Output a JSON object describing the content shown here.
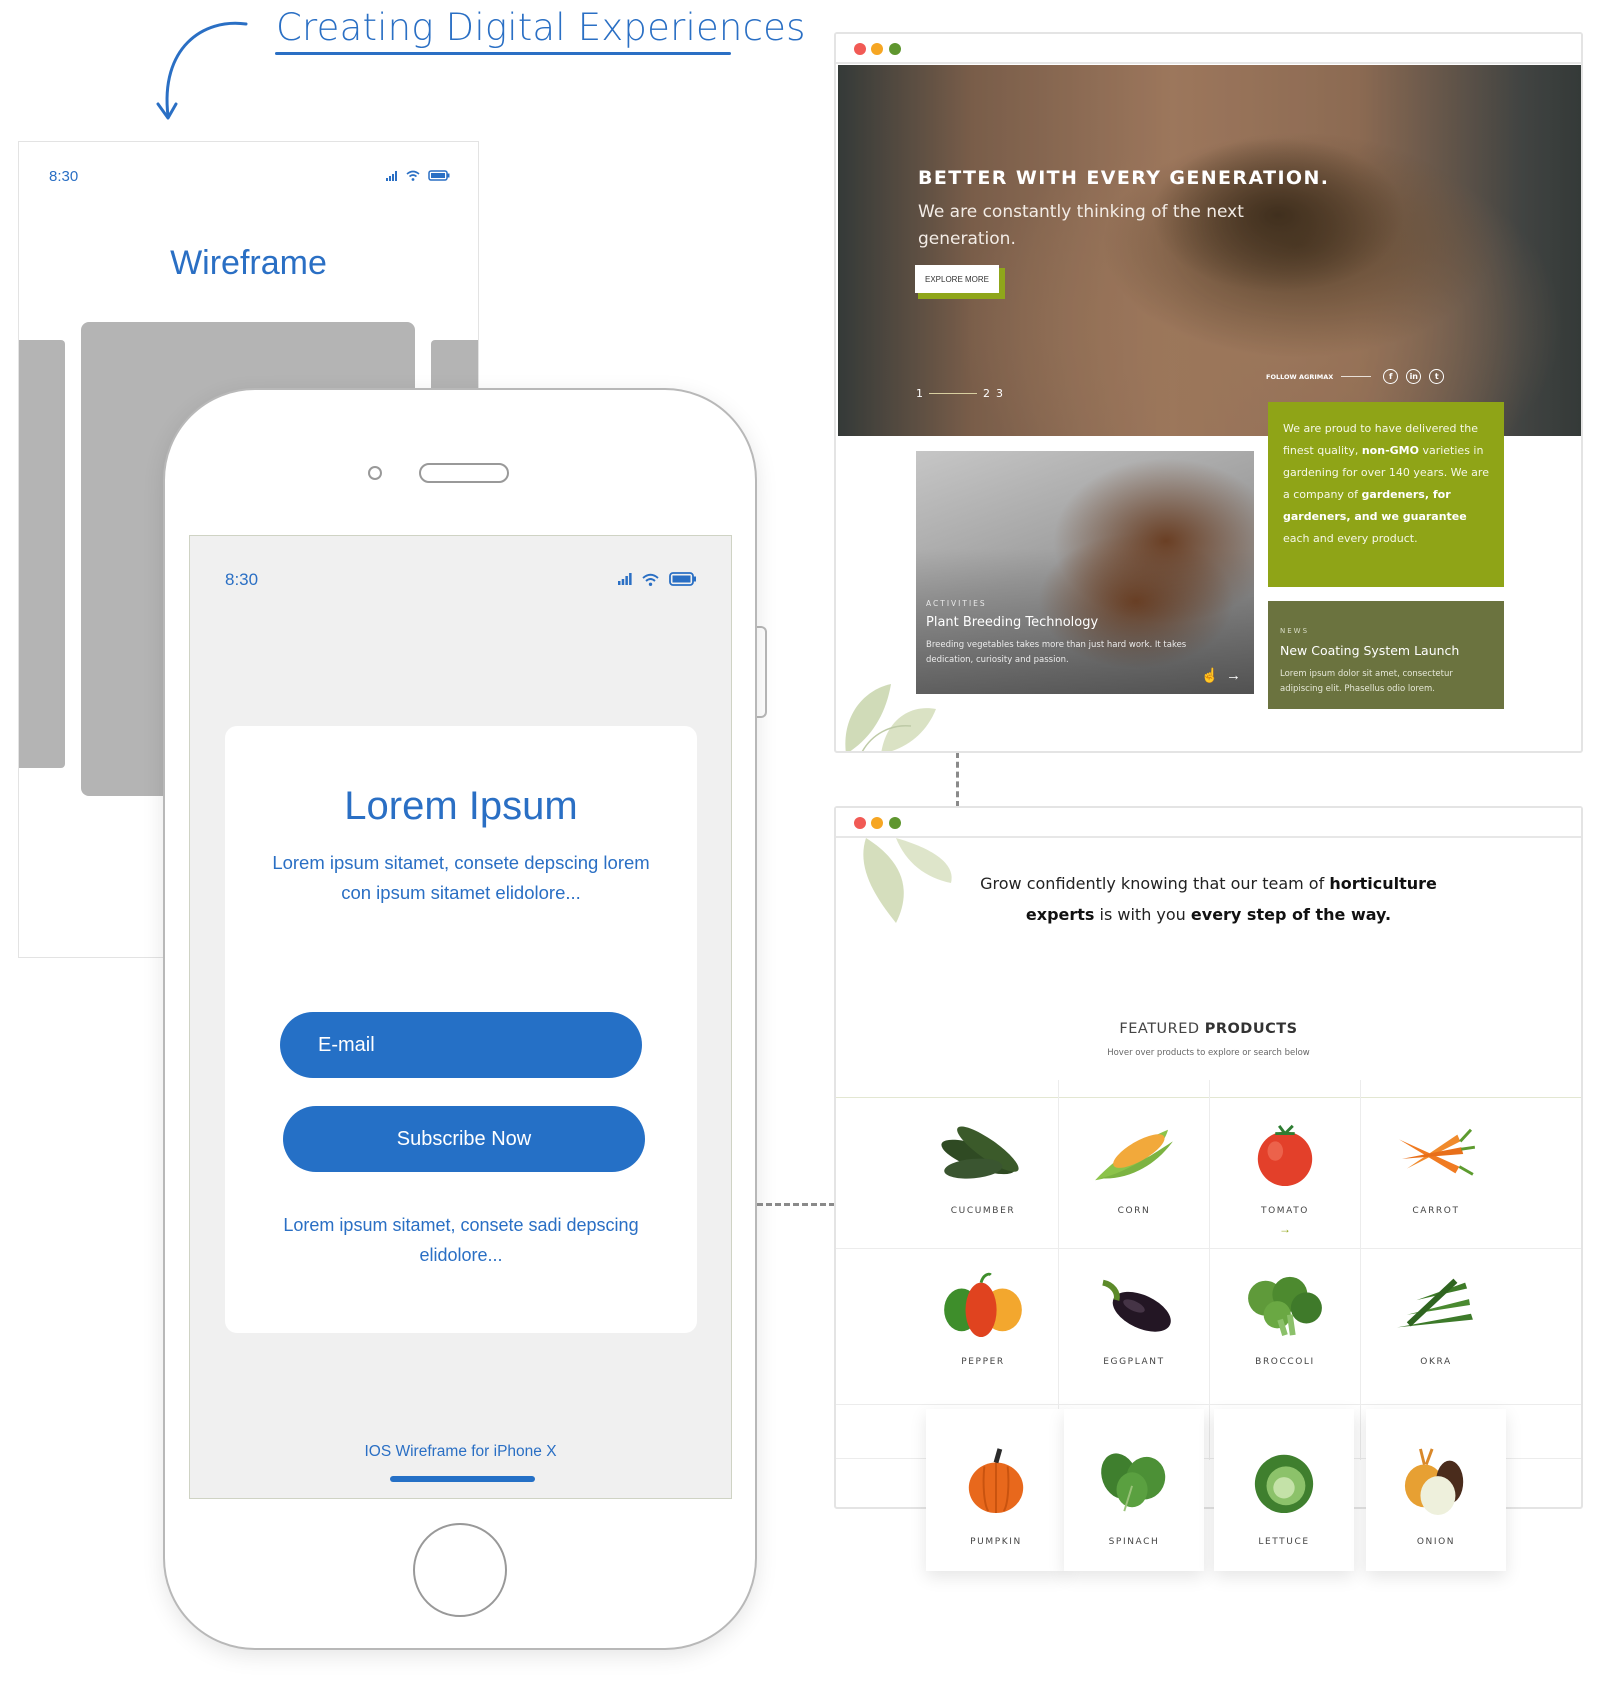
{
  "headline": {
    "text": "Creating Digital Experiences"
  },
  "wireframe_card": {
    "time": "8:30",
    "title": "Wireframe",
    "status_icons": [
      "signal-icon",
      "wifi-icon",
      "battery-icon"
    ]
  },
  "phone": {
    "time": "8:30",
    "status_icons": [
      "signal-icon",
      "wifi-icon",
      "battery-icon"
    ],
    "card_title": "Lorem Ipsum",
    "card_subtitle": "Lorem ipsum sitamet, consete depscing lorem con ipsum sitamet elidolore...",
    "email_placeholder": "E-mail",
    "subscribe_label": "Subscribe Now",
    "card_footer": "Lorem ipsum sitamet, consete sadi depscing elidolore...",
    "caption": "IOS Wireframe for iPhone X",
    "accent_color": "#2570c6"
  },
  "browser_1": {
    "window_controls": [
      "close",
      "minimize",
      "maximize"
    ],
    "hero": {
      "title": "BETTER WITH EVERY GENERATION.",
      "subtitle": "We are constantly thinking of the next generation.",
      "cta_label": "EXPLORE MORE",
      "pager": [
        "1",
        "2",
        "3"
      ],
      "follow_label": "FOLLOW AGRIMAX",
      "social": [
        "facebook-icon",
        "linkedin-icon",
        "twitter-icon"
      ],
      "social_glyphs": [
        "f",
        "in",
        "t"
      ]
    },
    "promo": {
      "segments": [
        {
          "text": "We are proud to have delivered the finest quality, ",
          "bold": false
        },
        {
          "text": "non-GMO",
          "bold": true
        },
        {
          "text": " varieties in gardening for over 140 years. We are a company of ",
          "bold": false
        },
        {
          "text": "gardeners, for gardeners, and we guarantee",
          "bold": true
        },
        {
          "text": " each and every product.",
          "bold": false
        }
      ],
      "color": "#8fa417"
    },
    "activities": {
      "kicker": "ACTIVITIES",
      "title": "Plant Breeding Technology",
      "body": "Breeding vegetables takes more than just hard work. It takes dedication, curiosity and passion.",
      "arrow": "→"
    },
    "news": {
      "kicker": "NEWS",
      "title": "New Coating System Launch",
      "body": "Lorem ipsum dolor sit amet, consectetur adipiscing elit. Phasellus odio lorem.",
      "color": "#6b733f"
    }
  },
  "browser_2": {
    "window_controls": [
      "close",
      "minimize",
      "maximize"
    ],
    "tagline": {
      "line1_normal": "Grow confidently knowing that our team of ",
      "line1_bold": "horticulture",
      "line2_bold_a": "experts",
      "line2_normal": " is with you ",
      "line2_bold_b": "every step of the way."
    },
    "featured": {
      "title_normal": "FEATURED ",
      "title_bold": "PRODUCTS",
      "subtitle": "Hover over products to explore or search below"
    },
    "products": [
      {
        "name": "CUCUMBER",
        "icon": "cucumber-icon"
      },
      {
        "name": "CORN",
        "icon": "corn-icon"
      },
      {
        "name": "TOMATO",
        "icon": "tomato-icon",
        "arrow": "→"
      },
      {
        "name": "CARROT",
        "icon": "carrot-icon"
      },
      {
        "name": "PEPPER",
        "icon": "pepper-icon"
      },
      {
        "name": "EGGPLANT",
        "icon": "eggplant-icon"
      },
      {
        "name": "BROCCOLI",
        "icon": "broccoli-icon"
      },
      {
        "name": "OKRA",
        "icon": "okra-icon"
      },
      {
        "name": "PUMPKIN",
        "icon": "pumpkin-icon"
      },
      {
        "name": "SPINACH",
        "icon": "spinach-icon"
      },
      {
        "name": "LETTUCE",
        "icon": "lettuce-icon"
      },
      {
        "name": "ONION",
        "icon": "onion-icon"
      }
    ]
  }
}
